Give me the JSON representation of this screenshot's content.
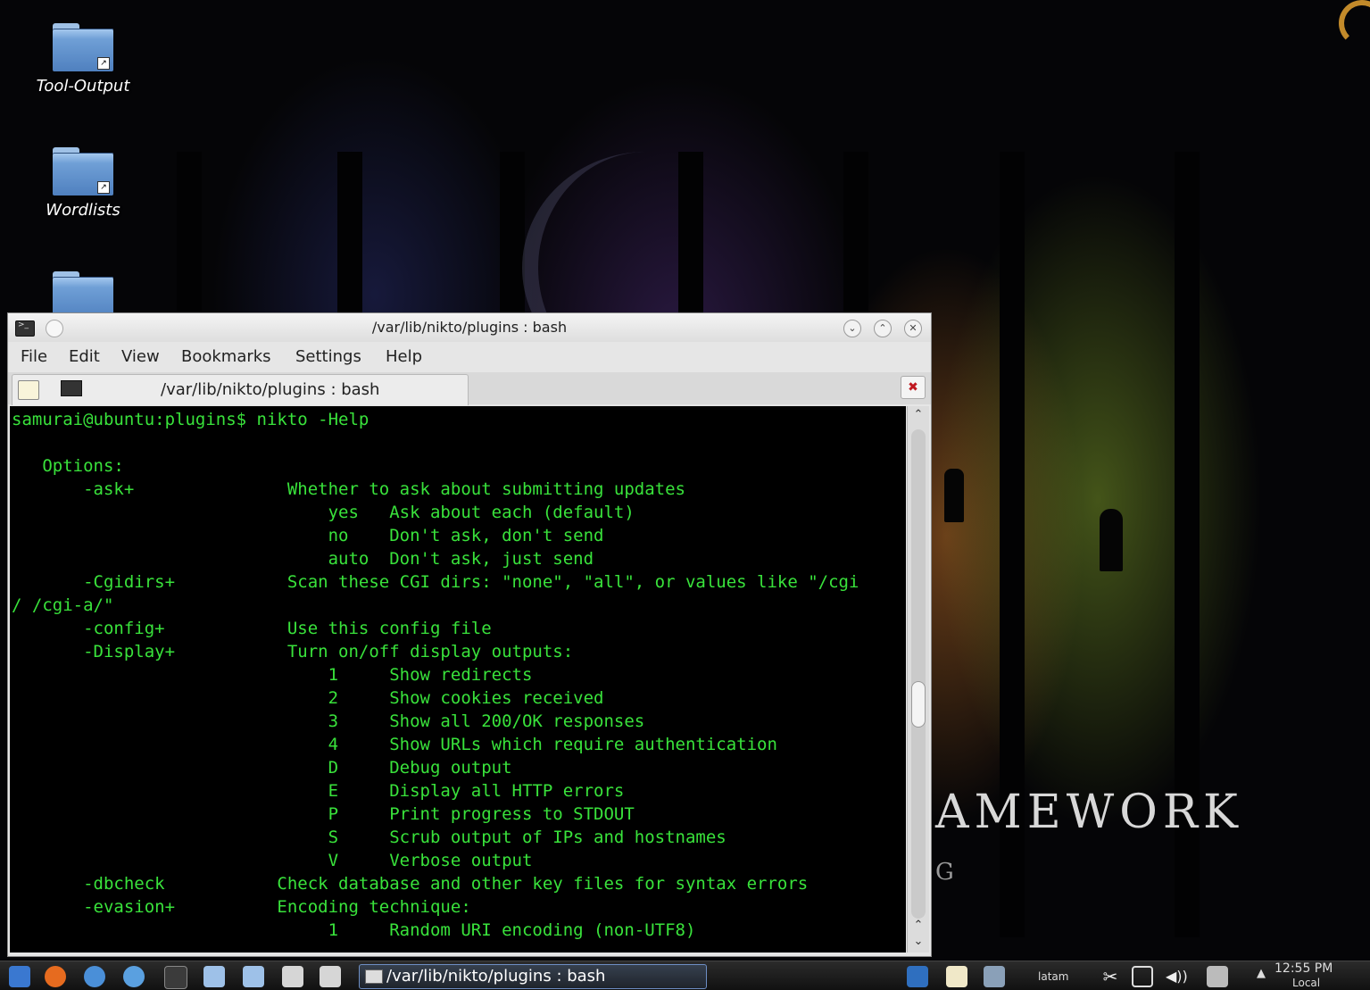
{
  "desktop": {
    "icons": [
      {
        "label": "Tool-Output"
      },
      {
        "label": "Wordlists"
      },
      {
        "label": ""
      }
    ],
    "wallpaper_text": "AMEWORK",
    "wallpaper_text2": "G"
  },
  "window": {
    "title": "/var/lib/nikto/plugins : bash",
    "menu": [
      "File",
      "Edit",
      "View",
      "Bookmarks",
      "Settings",
      "Help"
    ],
    "tab_label": "/var/lib/nikto/plugins : bash",
    "terminal_lines": [
      "samurai@ubuntu:plugins$ nikto -Help",
      "",
      "   Options:",
      "       -ask+               Whether to ask about submitting updates",
      "                               yes   Ask about each (default)",
      "                               no    Don't ask, don't send",
      "                               auto  Don't ask, just send",
      "       -Cgidirs+           Scan these CGI dirs: \"none\", \"all\", or values like \"/cgi",
      "/ /cgi-a/\"",
      "       -config+            Use this config file",
      "       -Display+           Turn on/off display outputs:",
      "                               1     Show redirects",
      "                               2     Show cookies received",
      "                               3     Show all 200/OK responses",
      "                               4     Show URLs which require authentication",
      "                               D     Debug output",
      "                               E     Display all HTTP errors",
      "                               P     Print progress to STDOUT",
      "                               S     Scrub output of IPs and hostnames",
      "                               V     Verbose output",
      "       -dbcheck           Check database and other key files for syntax errors",
      "       -evasion+          Encoding technique:",
      "                               1     Random URI encoding (non-UTF8)"
    ],
    "text_color": "#39e23b",
    "background_color": "#000000"
  },
  "taskbar": {
    "task_label": "/var/lib/nikto/plugins : bash",
    "keyboard_layout": "latam",
    "clock_time": "12:55 PM",
    "clock_zone": "Local",
    "launcher_icons": [
      "kde-menu-icon",
      "firefox-icon",
      "chromium-icon",
      "network-icon",
      "terminal-icon",
      "text-editor-icon",
      "text-editor-icon",
      "notes-icon",
      "notes-icon"
    ],
    "tray_icons": [
      "display-icon",
      "clipboard-icon",
      "device-icon",
      "scissors-icon",
      "screen-icon",
      "volume-icon",
      "battery-icon"
    ]
  }
}
